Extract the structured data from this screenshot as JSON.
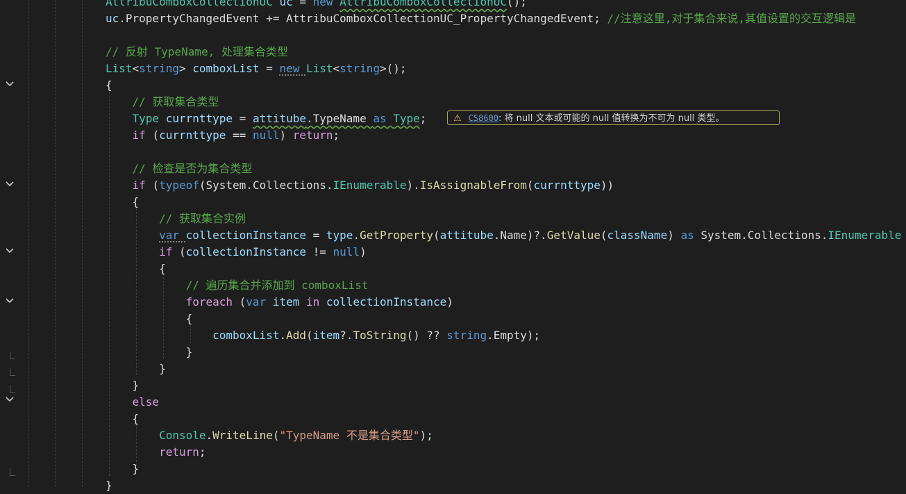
{
  "editor": {
    "lines": [
      [
        {
          "t": "AttribuComboxCollectionUC ",
          "c": "type"
        },
        {
          "t": "uc",
          "c": "var"
        },
        {
          "t": " = ",
          "c": "plain"
        },
        {
          "t": "new ",
          "c": "kw"
        },
        {
          "t": "AttribuComboxCollectionUC",
          "c": "type"
        },
        {
          "t": "();",
          "c": "plain"
        }
      ],
      [
        {
          "t": "uc",
          "c": "var"
        },
        {
          "t": ".PropertyChangedEvent += AttribuComboxCollectionUC_PropertyChangedEvent; ",
          "c": "plain"
        },
        {
          "t": "//注意这里,对于集合来说,其值设置的交互逻辑是",
          "c": "cmt"
        }
      ],
      [],
      [
        {
          "t": "// 反射 TypeName, 处理集合类型",
          "c": "cmt"
        }
      ],
      [
        {
          "t": "List",
          "c": "type"
        },
        {
          "t": "<",
          "c": "plain"
        },
        {
          "t": "string",
          "c": "kw"
        },
        {
          "t": "> ",
          "c": "plain"
        },
        {
          "t": "comboxList",
          "c": "var"
        },
        {
          "t": " = ",
          "c": "plain"
        },
        {
          "t": "new ",
          "c": "kw"
        },
        {
          "t": "List",
          "c": "type"
        },
        {
          "t": "<",
          "c": "plain"
        },
        {
          "t": "string",
          "c": "kw"
        },
        {
          "t": ">();",
          "c": "plain"
        }
      ],
      [
        {
          "t": "{",
          "c": "plain"
        }
      ],
      [
        {
          "t": "    ",
          "c": "plain"
        },
        {
          "t": "// 获取集合类型",
          "c": "cmt"
        }
      ],
      [
        {
          "t": "    ",
          "c": "plain"
        },
        {
          "t": "Type ",
          "c": "type"
        },
        {
          "t": "currnttype",
          "c": "var"
        },
        {
          "t": " = ",
          "c": "plain"
        },
        {
          "t": "attitube",
          "c": "var"
        },
        {
          "t": ".TypeName ",
          "c": "plain"
        },
        {
          "t": "as ",
          "c": "kw"
        },
        {
          "t": "Type",
          "c": "type"
        },
        {
          "t": ";",
          "c": "plain"
        }
      ],
      [
        {
          "t": "    ",
          "c": "plain"
        },
        {
          "t": "if ",
          "c": "ctrl"
        },
        {
          "t": "(",
          "c": "plain"
        },
        {
          "t": "currnttype",
          "c": "var"
        },
        {
          "t": " == ",
          "c": "plain"
        },
        {
          "t": "null",
          "c": "kw"
        },
        {
          "t": ") ",
          "c": "plain"
        },
        {
          "t": "return",
          "c": "ctrl"
        },
        {
          "t": ";",
          "c": "plain"
        }
      ],
      [],
      [
        {
          "t": "    ",
          "c": "plain"
        },
        {
          "t": "// 检查是否为集合类型",
          "c": "cmt"
        }
      ],
      [
        {
          "t": "    ",
          "c": "plain"
        },
        {
          "t": "if ",
          "c": "ctrl"
        },
        {
          "t": "(",
          "c": "plain"
        },
        {
          "t": "typeof",
          "c": "kw"
        },
        {
          "t": "(System.Collections.",
          "c": "plain"
        },
        {
          "t": "IEnumerable",
          "c": "type"
        },
        {
          "t": ").",
          "c": "plain"
        },
        {
          "t": "IsAssignableFrom",
          "c": "meth"
        },
        {
          "t": "(",
          "c": "plain"
        },
        {
          "t": "currnttype",
          "c": "var"
        },
        {
          "t": "))",
          "c": "plain"
        }
      ],
      [
        {
          "t": "    {",
          "c": "plain"
        }
      ],
      [
        {
          "t": "        ",
          "c": "plain"
        },
        {
          "t": "// 获取集合实例",
          "c": "cmt"
        }
      ],
      [
        {
          "t": "        ",
          "c": "plain"
        },
        {
          "t": "var ",
          "c": "kw"
        },
        {
          "t": "collectionInstance",
          "c": "var"
        },
        {
          "t": " = ",
          "c": "plain"
        },
        {
          "t": "type",
          "c": "var"
        },
        {
          "t": ".",
          "c": "plain"
        },
        {
          "t": "GetProperty",
          "c": "meth"
        },
        {
          "t": "(",
          "c": "plain"
        },
        {
          "t": "attitube",
          "c": "var"
        },
        {
          "t": ".Name)?.",
          "c": "plain"
        },
        {
          "t": "GetValue",
          "c": "meth"
        },
        {
          "t": "(",
          "c": "plain"
        },
        {
          "t": "className",
          "c": "var"
        },
        {
          "t": ") ",
          "c": "plain"
        },
        {
          "t": "as ",
          "c": "kw"
        },
        {
          "t": "System.Collections.",
          "c": "plain"
        },
        {
          "t": "IEnumerable",
          "c": "type"
        }
      ],
      [
        {
          "t": "        ",
          "c": "plain"
        },
        {
          "t": "if ",
          "c": "ctrl"
        },
        {
          "t": "(",
          "c": "plain"
        },
        {
          "t": "collectionInstance",
          "c": "var"
        },
        {
          "t": " != ",
          "c": "plain"
        },
        {
          "t": "null",
          "c": "kw"
        },
        {
          "t": ")",
          "c": "plain"
        }
      ],
      [
        {
          "t": "        {",
          "c": "plain"
        }
      ],
      [
        {
          "t": "            ",
          "c": "plain"
        },
        {
          "t": "// 遍历集合并添加到 comboxList",
          "c": "cmt"
        }
      ],
      [
        {
          "t": "            ",
          "c": "plain"
        },
        {
          "t": "foreach ",
          "c": "ctrl"
        },
        {
          "t": "(",
          "c": "plain"
        },
        {
          "t": "var ",
          "c": "kw"
        },
        {
          "t": "item",
          "c": "var"
        },
        {
          "t": " in ",
          "c": "ctrl"
        },
        {
          "t": "collectionInstance",
          "c": "var"
        },
        {
          "t": ")",
          "c": "plain"
        }
      ],
      [
        {
          "t": "            {",
          "c": "plain"
        }
      ],
      [
        {
          "t": "                ",
          "c": "plain"
        },
        {
          "t": "comboxList",
          "c": "var"
        },
        {
          "t": ".",
          "c": "plain"
        },
        {
          "t": "Add",
          "c": "meth"
        },
        {
          "t": "(",
          "c": "plain"
        },
        {
          "t": "item",
          "c": "var"
        },
        {
          "t": "?.",
          "c": "plain"
        },
        {
          "t": "ToString",
          "c": "meth"
        },
        {
          "t": "() ?? ",
          "c": "plain"
        },
        {
          "t": "string",
          "c": "kw"
        },
        {
          "t": ".Empty);",
          "c": "plain"
        }
      ],
      [
        {
          "t": "            }",
          "c": "plain"
        }
      ],
      [
        {
          "t": "        }",
          "c": "plain"
        }
      ],
      [
        {
          "t": "    }",
          "c": "plain"
        }
      ],
      [
        {
          "t": "    ",
          "c": "plain"
        },
        {
          "t": "else",
          "c": "ctrl"
        }
      ],
      [
        {
          "t": "    {",
          "c": "plain"
        }
      ],
      [
        {
          "t": "        ",
          "c": "plain"
        },
        {
          "t": "Console",
          "c": "type"
        },
        {
          "t": ".",
          "c": "plain"
        },
        {
          "t": "WriteLine",
          "c": "meth"
        },
        {
          "t": "(",
          "c": "plain"
        },
        {
          "t": "\"TypeName 不是集合类型\"",
          "c": "str"
        },
        {
          "t": ");",
          "c": "plain"
        }
      ],
      [
        {
          "t": "        ",
          "c": "plain"
        },
        {
          "t": "return",
          "c": "ctrl"
        },
        {
          "t": ";",
          "c": "plain"
        }
      ],
      [
        {
          "t": "    }",
          "c": "plain"
        }
      ],
      [
        {
          "t": "}",
          "c": "plain"
        }
      ]
    ]
  },
  "warning": {
    "icon": "warning-triangle-icon",
    "code": "CS8600",
    "message": ": 将 null 文本或可能的 null 值转换为不可为 null 类型。"
  },
  "colors": {
    "background": "#1e1e1e",
    "keyword": "#569cd6",
    "control": "#d8a0df",
    "type": "#4ec9b0",
    "method": "#dcdcaa",
    "variable": "#9cdcfe",
    "string": "#d69d85",
    "comment": "#57a64a"
  }
}
